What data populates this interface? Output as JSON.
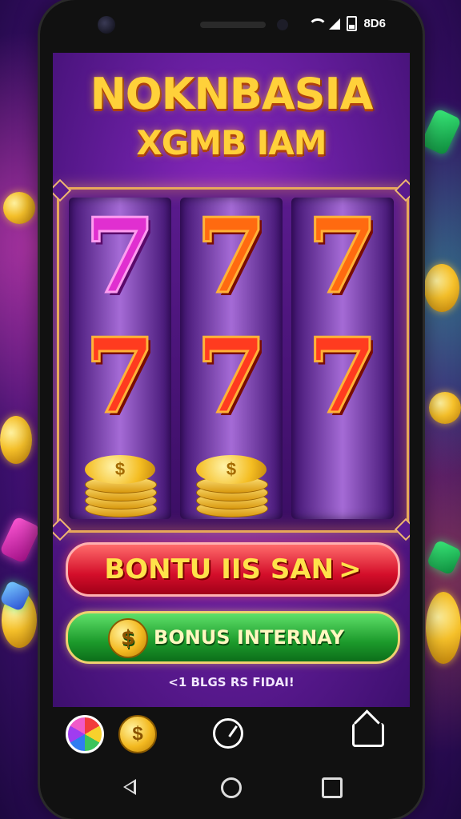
{
  "status_bar": {
    "clock": "8D6"
  },
  "game": {
    "title_line1": "NOKNBASIA",
    "title_line2": "XGMB IAM"
  },
  "reels": {
    "symbols": [
      "7",
      "7",
      "7",
      "7",
      "7",
      "7"
    ],
    "coin_symbol": "$"
  },
  "buttons": {
    "primary_label": "BONTU IIS SAN",
    "primary_arrow": ">",
    "secondary_label": "BONUS INTERNAY",
    "secondary_coin_symbol": "$"
  },
  "footnote": "<1 BLGS RS FIDAI!",
  "dock": {
    "coin_symbol": "$",
    "icons": [
      "color-wheel-icon",
      "coin-icon",
      "gauge-icon",
      "home-icon"
    ]
  },
  "navigation": {
    "icons": [
      "back-icon",
      "home-icon",
      "recents-icon"
    ]
  },
  "colors": {
    "primary_button": "#d40e2a",
    "secondary_button": "#1c9a2b",
    "title_gold": "#ffd13a",
    "background_purple": "#6b1fa3"
  }
}
